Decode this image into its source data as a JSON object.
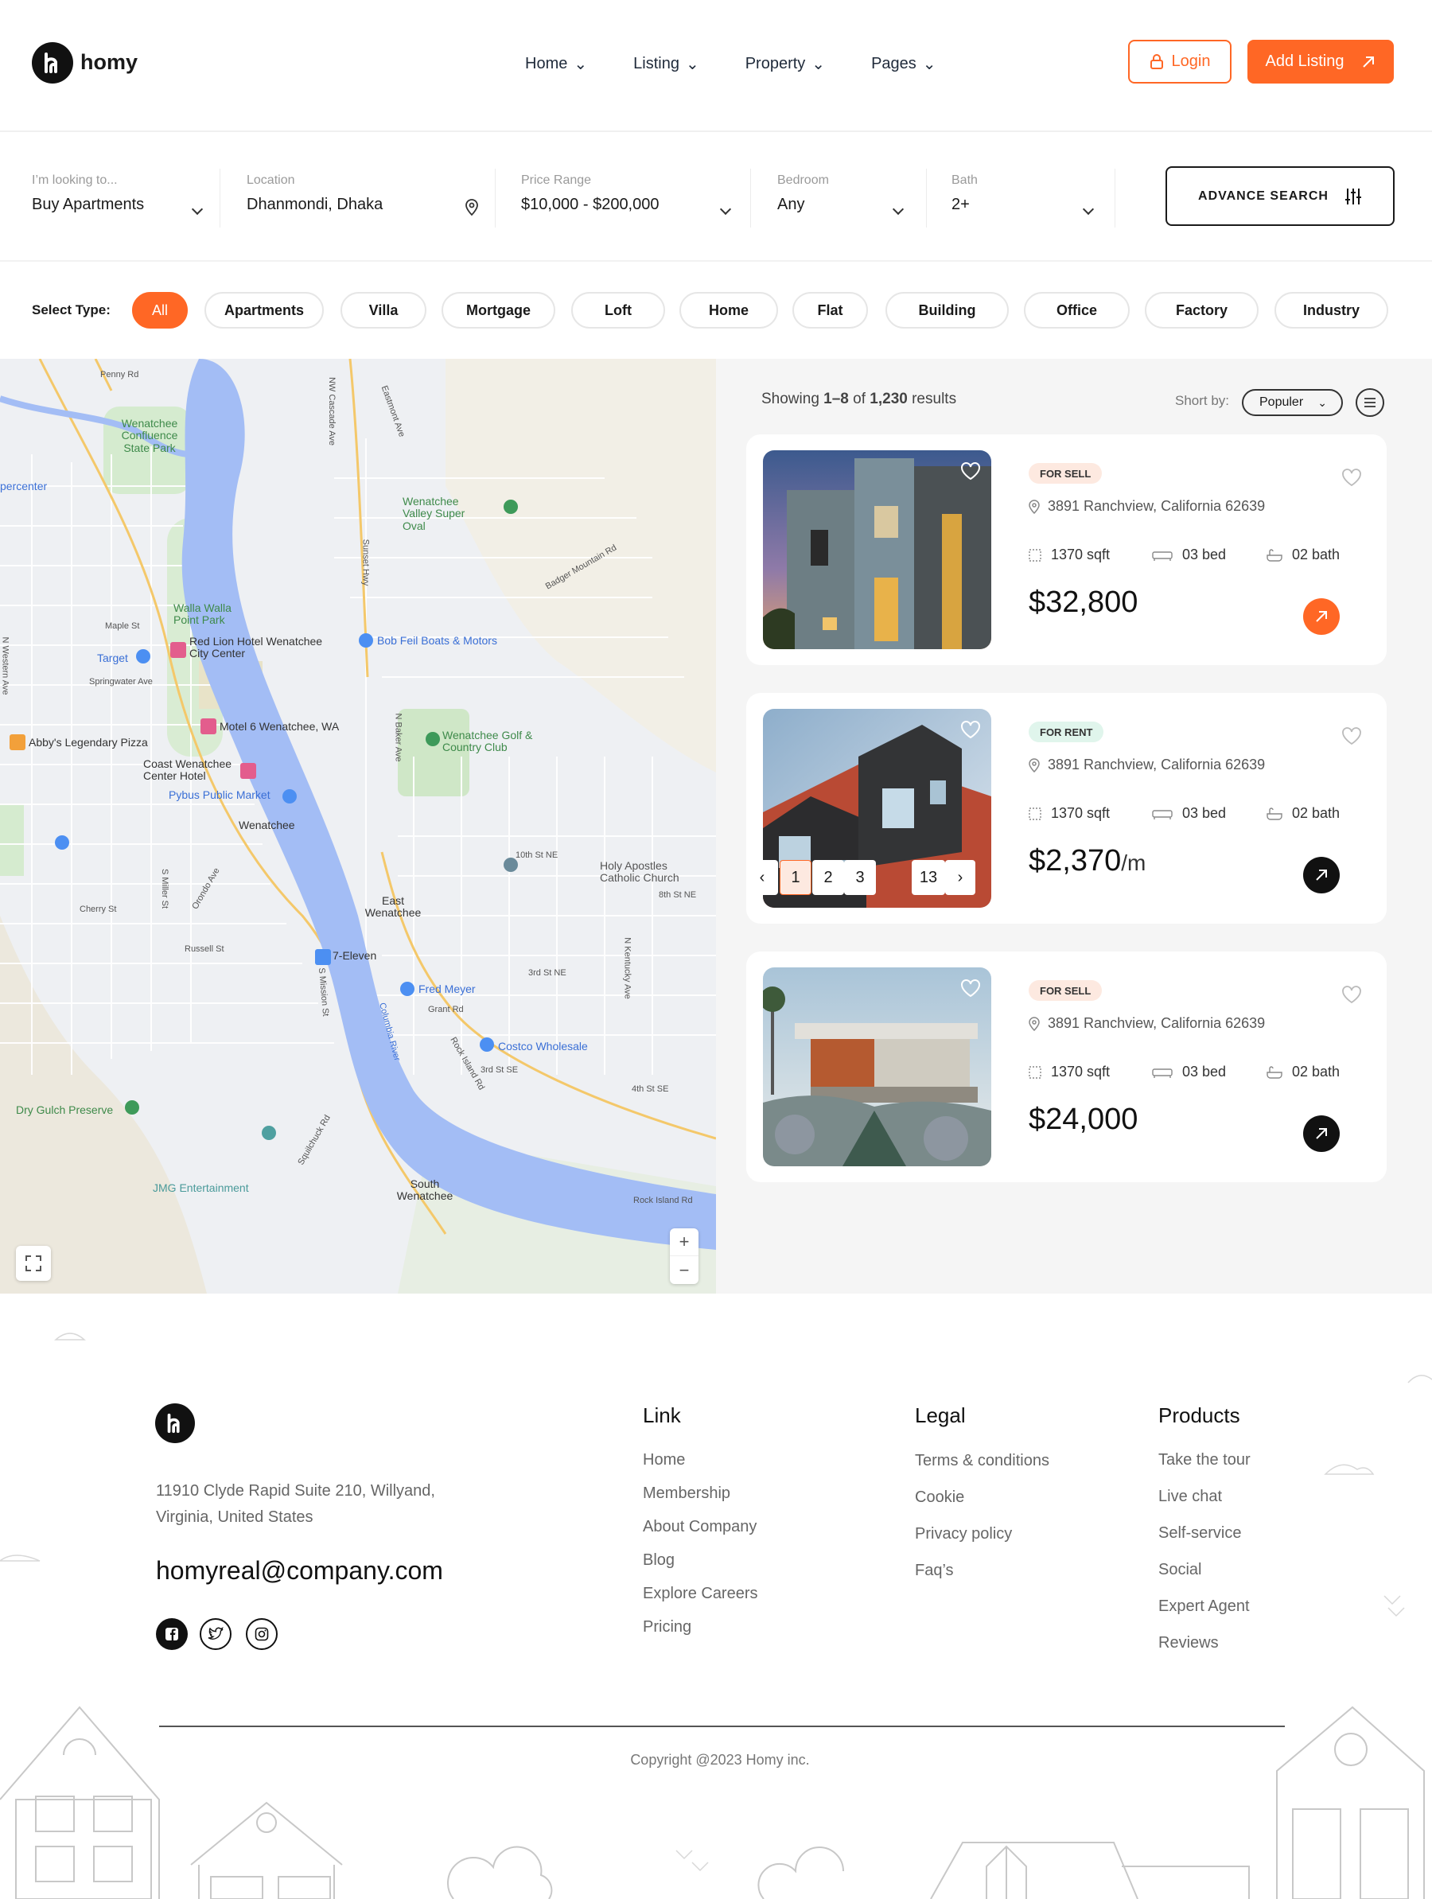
{
  "header": {
    "brand": "homy",
    "nav": [
      {
        "label": "Home"
      },
      {
        "label": "Listing"
      },
      {
        "label": "Property"
      },
      {
        "label": "Pages"
      }
    ],
    "login_label": "Login",
    "add_listing_label": "Add Listing"
  },
  "search": {
    "looking": {
      "label": "I’m looking to...",
      "value": "Buy Apartments"
    },
    "location": {
      "label": "Location",
      "value": "Dhanmondi, Dhaka"
    },
    "price": {
      "label": "Price Range",
      "value": "$10,000 - $200,000"
    },
    "bedroom": {
      "label": "Bedroom",
      "value": "Any"
    },
    "bath": {
      "label": "Bath",
      "value": "2+"
    },
    "advance_label": "ADVANCE SEARCH"
  },
  "types": {
    "label": "Select Type:",
    "items": [
      "All",
      "Apartments",
      "Villa",
      "Mortgage",
      "Loft",
      "Home",
      "Flat",
      "Building",
      "Office",
      "Factory",
      "Industry"
    ],
    "active": "All"
  },
  "map": {
    "labels": [
      "Penny Rd",
      "Wenatchee Confluence State Park",
      "percenter",
      "Wenatchee Valley Super Oval",
      "Walla Walla Point Park",
      "Red Lion Hotel Wenatchee City Center",
      "Bob Feil Boats & Motors",
      "Target",
      "Maple St",
      "Springwater Ave",
      "Motel 6 Wenatchee, WA",
      "Abby's Legendary Pizza",
      "Wenatchee Golf & Country Club",
      "Coast Wenatchee Center Hotel",
      "Pybus Public Market",
      "Wenatchee",
      "10th St NE",
      "Holy Apostles Catholic Church",
      "8th St NE",
      "East Wenatchee",
      "7-Eleven",
      "Cherry St",
      "Russell St",
      "Fred Meyer",
      "Grant Rd",
      "3rd St NE",
      "Costco Wholesale",
      "3rd St SE",
      "4th St SE",
      "Dry Gulch Preserve",
      "JMG Entertainment",
      "South Wenatchee",
      "Rock Island Rd",
      "Columbia River",
      "Badger Mountain Rd",
      "Sunset Hwy",
      "NW Cascade Ave",
      "N Baker Ave",
      "Eastmont Ave",
      "N Kentucky Ave",
      "S Mission St",
      "Squilchuck Rd",
      "S Miller St",
      "Orondo Ave",
      "N Western Ave",
      "Rock Island Rd"
    ],
    "zoom_in": "+",
    "zoom_out": "−"
  },
  "results": {
    "showing_prefix": "Showing ",
    "range": "1–8",
    "of": " of ",
    "total": "1,230",
    "suffix": " results",
    "sort_label": "Short by:",
    "sort_value": "Populer"
  },
  "cards": [
    {
      "badge": "FOR SELL",
      "address": "3891 Ranchview, California 62639",
      "sqft": "1370 sqft",
      "bed": "03 bed",
      "bath": "02 bath",
      "price": "$32,800",
      "unit": ""
    },
    {
      "badge": "FOR RENT",
      "address": "3891 Ranchview, California 62639",
      "sqft": "1370 sqft",
      "bed": "03 bed",
      "bath": "02 bath",
      "price": "$2,370",
      "unit": "/m"
    },
    {
      "badge": "FOR SELL",
      "address": "3891 Ranchview, California 62639",
      "sqft": "1370 sqft",
      "bed": "03 bed",
      "bath": "02 bath",
      "price": "$24,000",
      "unit": ""
    }
  ],
  "pagination": {
    "pages": [
      "1",
      "2",
      "3"
    ],
    "last": "13",
    "current": "1"
  },
  "footer": {
    "address": "11910 Clyde Rapid Suite 210, Willyand, Virginia, United States",
    "email": "homyreal@company.com",
    "link": {
      "title": "Link",
      "items": [
        "Home",
        "Membership",
        "About Company",
        "Blog",
        "Explore Careers",
        "Pricing"
      ]
    },
    "legal": {
      "title": "Legal",
      "items": [
        "Terms & conditions",
        "Cookie",
        "Privacy policy",
        "Faq’s"
      ]
    },
    "products": {
      "title": "Products",
      "items": [
        "Take the tour",
        "Live chat",
        "Self-service",
        "Social",
        "Expert Agent",
        "Reviews"
      ]
    },
    "copyright": "Copyright @2023 Homy inc."
  },
  "colors": {
    "accent": "#ff6725",
    "dark": "#111111",
    "sell_badge": "#fde9e0",
    "rent_badge": "#e0f5ec"
  }
}
